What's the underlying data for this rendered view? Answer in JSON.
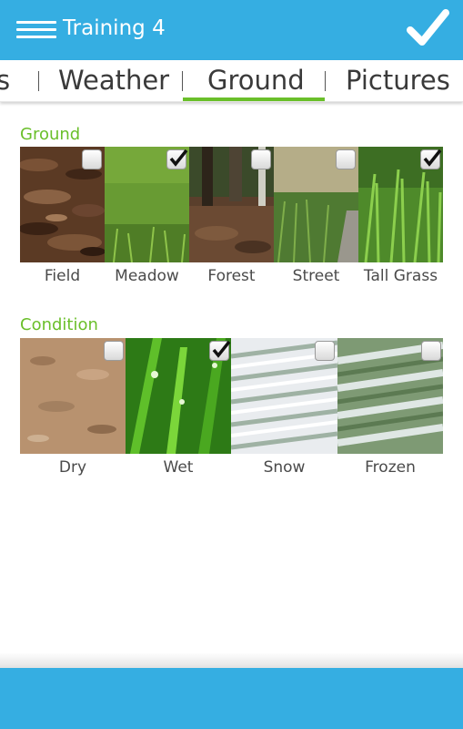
{
  "app": {
    "title": "Training 4",
    "accent_color": "#35aee2",
    "confirm_icon": "checkmark-icon",
    "menu_icon": "menu-icon"
  },
  "tabs": {
    "items": [
      {
        "label": "s",
        "selected": false
      },
      {
        "label": "Weather",
        "selected": false
      },
      {
        "label": "Ground",
        "selected": true
      },
      {
        "label": "Pictures",
        "selected": false
      }
    ],
    "indicator_color": "#6abf2a"
  },
  "ground": {
    "title": "Ground",
    "items": [
      {
        "label": "Field",
        "checked": false
      },
      {
        "label": "Meadow",
        "checked": true
      },
      {
        "label": "Forest",
        "checked": false
      },
      {
        "label": "Street",
        "checked": false
      },
      {
        "label": "Tall Grass",
        "checked": true
      }
    ]
  },
  "condition": {
    "title": "Condition",
    "items": [
      {
        "label": "Dry",
        "checked": false
      },
      {
        "label": "Wet",
        "checked": true
      },
      {
        "label": "Snow",
        "checked": false
      },
      {
        "label": "Frozen",
        "checked": false
      }
    ]
  }
}
